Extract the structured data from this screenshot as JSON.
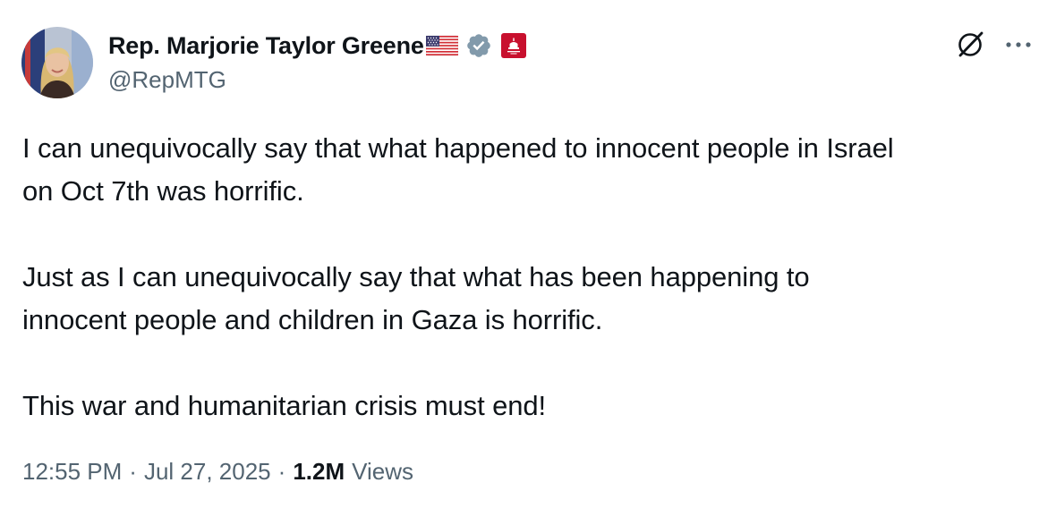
{
  "author": {
    "display_name": "Rep. Marjorie Taylor Greene",
    "handle": "@RepMTG",
    "badges": [
      "us-flag-icon",
      "verified-badge-icon",
      "house-affiliate-badge-icon"
    ]
  },
  "tweet": {
    "paragraphs": [
      "I can unequivocally say that what happened to innocent people in Israel\non Oct 7th was horrific.",
      "Just as I can unequivocally say that what has been happening to\ninnocent people and children in Gaza is horrific.",
      "This war and humanitarian crisis must end!"
    ]
  },
  "meta": {
    "time": "12:55 PM",
    "separator": "·",
    "date": "Jul 27, 2025",
    "views_count": "1.2M",
    "views_label": "Views"
  },
  "icons": {
    "grok": "grok-icon",
    "more": "more-icon"
  },
  "colors": {
    "text_primary": "#0f1419",
    "text_secondary": "#536471",
    "verified_badge": "#829aab",
    "affiliate_badge": "#c8102e"
  }
}
